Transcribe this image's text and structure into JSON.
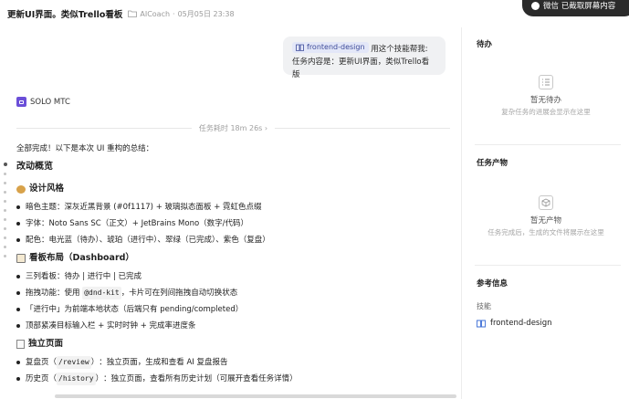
{
  "header": {
    "title": "更新UI界面。类似Trello看板",
    "project": "AICoach",
    "separator": "·",
    "timestamp": "05月05日 23:38"
  },
  "notification": {
    "text": "微信 已截取屏幕内容"
  },
  "conversation": {
    "user_message": {
      "skill_chip": "frontend-design",
      "line1_suffix": "用这个技能帮我:",
      "line2": "任务内容是：更新UI界面，类似Trello看版"
    },
    "agent_name": "SOLO MTC",
    "elapsed": "任务耗时 18m 26s",
    "elapsed_chevron": "›",
    "summary_intro": "全部完成！以下是本次 UI 重构的总结：",
    "overview_heading": "改动概览",
    "sections": [
      {
        "heading": "设计风格",
        "items": [
          "暗色主题：深灰近黑背景 (#0f1117) + 玻璃拟态面板 + 霓虹色点缀",
          "字体：Noto Sans SC（正文）+ JetBrains Mono（数字/代码）",
          "配色：电光蓝（待办）、琥珀（进行中）、翠绿（已完成）、紫色（复盘）"
        ]
      },
      {
        "heading": "看板布局（Dashboard）",
        "items": [
          "三列看板：待办 | 进行中 | 已完成",
          "拖拽功能：使用",
          "「进行中」为前端本地状态（后端只有 pending/completed）",
          "顶部紧凑目标输入栏 + 实时时钟 + 完成率进度条"
        ],
        "drag_code": "@dnd-kit",
        "drag_suffix": "，卡片可在列间拖拽自动切换状态"
      },
      {
        "heading": "独立页面",
        "items": [
          "复盘页",
          "历史页"
        ],
        "review_code": "/review",
        "review_suffix": "：独立页面，生成和查看 AI 复盘报告",
        "history_code": "/history",
        "history_suffix": "：独立页面，查看所有历史计划（可展开查看任务详情）",
        "paren_open": "（",
        "paren_close": "）"
      }
    ]
  },
  "sidebar": {
    "todo_title": "待办",
    "todo_empty_title": "暂无待办",
    "todo_empty_sub": "复杂任务的进展会显示在这里",
    "artifacts_title": "任务产物",
    "artifacts_empty_title": "暂无产物",
    "artifacts_empty_sub": "任务完成后，生成的文件将展示在这里",
    "reference_title": "参考信息",
    "skills_label": "技能",
    "skill_name": "frontend-design"
  },
  "colors": {
    "agent_avatar": "#6b4fd8",
    "skill_chip_bg": "#e3e7f8",
    "skill_chip_text": "#3d4b99",
    "notification_bg": "#2b2b2b"
  },
  "icons": {
    "project": "folder-icon",
    "skill": "book-icon",
    "todo_empty": "checklist-icon",
    "artifacts_empty": "cube-icon"
  }
}
